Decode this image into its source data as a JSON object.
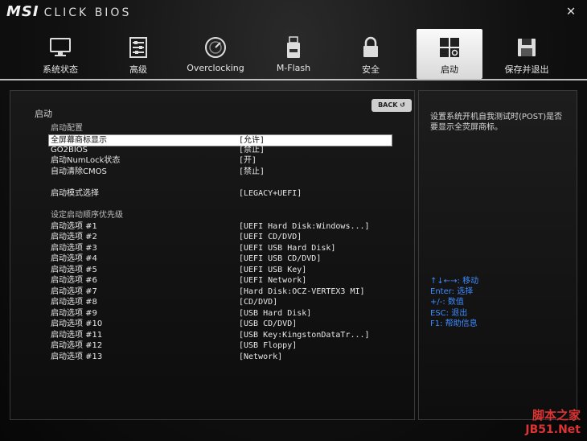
{
  "header": {
    "logo": "MSI",
    "logo_sub": "CLICK BIOS",
    "close": "✕"
  },
  "tabs": [
    {
      "label": "系统状态",
      "icon": "monitor-icon",
      "active": false
    },
    {
      "label": "高级",
      "icon": "settings-sliders-icon",
      "active": false
    },
    {
      "label": "Overclocking",
      "icon": "speedometer-icon",
      "active": false
    },
    {
      "label": "M-Flash",
      "icon": "usb-flash-icon",
      "active": false
    },
    {
      "label": "安全",
      "icon": "lock-icon",
      "active": false
    },
    {
      "label": "启动",
      "icon": "boot-icon",
      "active": true
    },
    {
      "label": "保存并退出",
      "icon": "floppy-disk-icon",
      "active": false
    }
  ],
  "main": {
    "section_title": "启动",
    "back_label": "BACK ↺",
    "groups": {
      "boot_config": "启动配置",
      "boot_order": "设定启动顺序优先级"
    },
    "settings": [
      {
        "name": "全屏幕商标显示",
        "value": "[允许]"
      },
      {
        "name": "GO2BIOS",
        "value": "[禁止]"
      },
      {
        "name": "启动NumLock状态",
        "value": "[开]"
      },
      {
        "name": "自动清除CMOS",
        "value": "[禁止]"
      }
    ],
    "boot_mode": {
      "name": "启动模式选择",
      "value": "[LEGACY+UEFI]"
    },
    "boot_options": [
      {
        "name": "启动选项 #1",
        "value": "[UEFI Hard Disk:Windows...]"
      },
      {
        "name": "启动选项 #2",
        "value": "[UEFI CD/DVD]"
      },
      {
        "name": "启动选项 #3",
        "value": "[UEFI USB Hard Disk]"
      },
      {
        "name": "启动选项 #4",
        "value": "[UEFI USB CD/DVD]"
      },
      {
        "name": "启动选项 #5",
        "value": "[UEFI USB Key]"
      },
      {
        "name": "启动选项 #6",
        "value": "[UEFI Network]"
      },
      {
        "name": "启动选项 #7",
        "value": "[Hard Disk:OCZ-VERTEX3 MI]"
      },
      {
        "name": "启动选项 #8",
        "value": "[CD/DVD]"
      },
      {
        "name": "启动选项 #9",
        "value": "[USB Hard Disk]"
      },
      {
        "name": "启动选项 #10",
        "value": "[USB CD/DVD]"
      },
      {
        "name": "启动选项 #11",
        "value": "[USB Key:KingstonDataTr...]"
      },
      {
        "name": "启动选项 #12",
        "value": "[USB Floppy]"
      },
      {
        "name": "启动选项 #13",
        "value": "[Network]"
      }
    ]
  },
  "help": {
    "description": "设置系统开机自我测试时(POST)是否要显示全荧屏商标。",
    "hints": [
      "↑↓←→: 移动",
      "Enter: 选择",
      "+/-: 数值",
      "ESC: 退出",
      "F1: 帮助信息"
    ]
  },
  "watermark": {
    "line1": "脚本之家",
    "line2": "JB51.Net"
  },
  "colors": {
    "accent_blue": "#3d8bff",
    "selection": "#ffffff",
    "watermark_red": "#dd3333"
  }
}
